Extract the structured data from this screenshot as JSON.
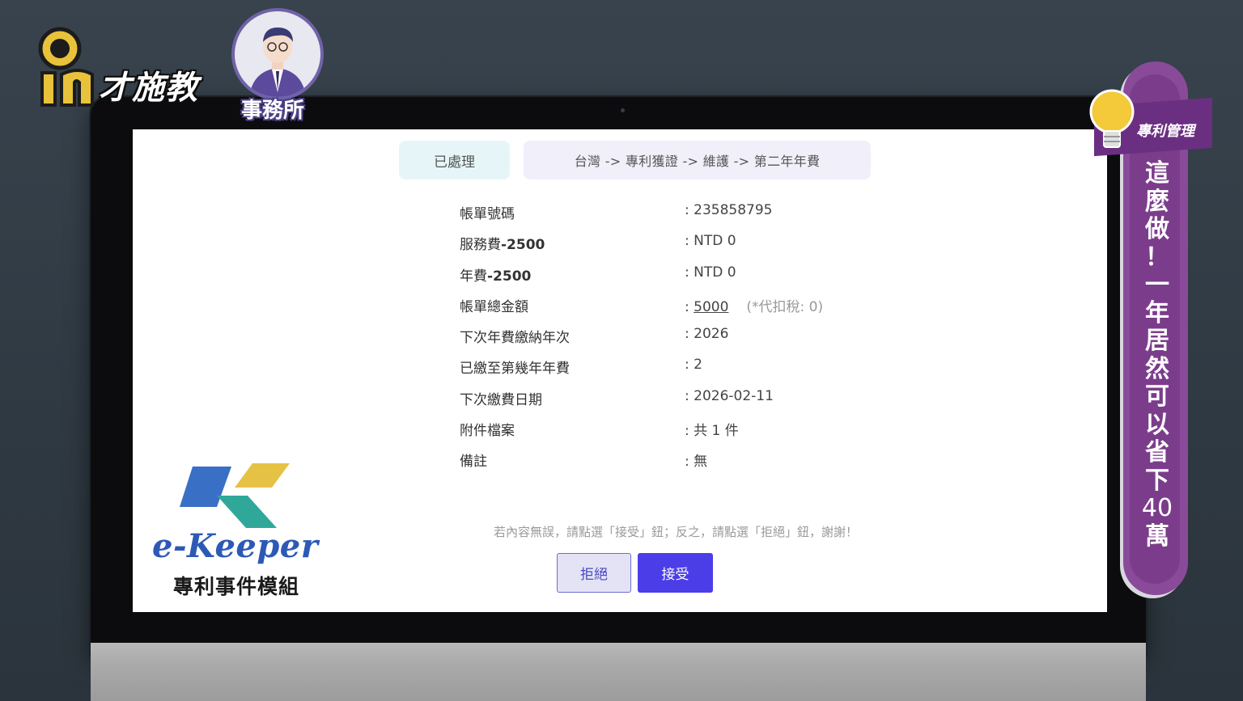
{
  "brand": {
    "name": "才施教",
    "avatar_label": "事務所"
  },
  "side_banner": {
    "tag": "專利管理",
    "headline_chars": [
      "這",
      "麼",
      "做",
      "！",
      "一",
      "年",
      "居",
      "然",
      "可",
      "以",
      "省",
      "下"
    ],
    "headline_number": "40",
    "headline_end": "萬"
  },
  "screen": {
    "status": "已處理",
    "breadcrumb": "台灣 -> 專利獲證 -> 維護 -> 第二年年費",
    "rows": [
      {
        "label": "帳單號碼",
        "label_bold": "",
        "value": ": 235858795"
      },
      {
        "label": "服務費",
        "label_bold": "-2500",
        "value": ": NTD 0"
      },
      {
        "label": "年費",
        "label_bold": "-2500",
        "value": ": NTD 0"
      },
      {
        "label": "帳單總金額",
        "label_bold": "",
        "value_prefix": ": ",
        "value_link": "5000",
        "value_note": "(*代扣稅: 0)"
      },
      {
        "label": "下次年費繳納年次",
        "label_bold": "",
        "value": ": 2026"
      },
      {
        "label": "已繳至第幾年年費",
        "label_bold": "",
        "value": ": 2"
      },
      {
        "label": "下次繳費日期",
        "label_bold": "",
        "value": ": 2026-02-11"
      },
      {
        "label": "附件檔案",
        "label_bold": "",
        "value": ": 共 1 件"
      },
      {
        "label": "備註",
        "label_bold": "",
        "value": ": 無"
      }
    ],
    "instruction": "若內容無誤，請點選「接受」鈕；反之，請點選「拒絕」鈕，謝謝！",
    "reject_label": "拒絕",
    "accept_label": "接受"
  },
  "ekeeper": {
    "word": "e-Keeper",
    "subtitle": "專利事件模組"
  },
  "colors": {
    "accent": "#4b3ee8",
    "banner": "#7b3d8b",
    "status_bg": "#e6f6f8"
  }
}
